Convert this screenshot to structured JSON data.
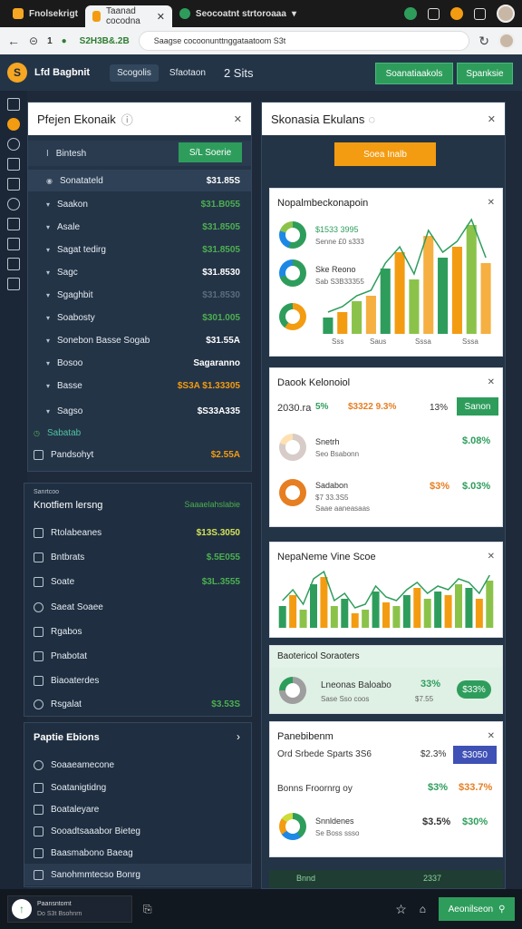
{
  "browser": {
    "tab1_title": "Fnolsekrigt",
    "tab2_title": "Taanad cocodna",
    "tab3_title": "Seocoatnt strtoroaaa",
    "url_number": "1",
    "url_host": "S2H3B&.2B",
    "url_path": "Saagse cocoonunttnggataatoom S3t",
    "tab2_close": "✕"
  },
  "app": {
    "name": "Lfd Bagbnit",
    "tabs": [
      "Scogolis",
      "Sfaotaon",
      "2 Sits"
    ],
    "btn_primary": "Soanatiaakols",
    "btn_secondary": "Spanksie"
  },
  "left_panel": {
    "title": "Pfejen Ekonaik",
    "header_row_label": "Bintesh",
    "header_btn": "S/L Soerie",
    "rows": [
      {
        "label": "Sonatateld",
        "value": "$31.85S"
      },
      {
        "label": "Saakon",
        "value": "$31.B055"
      },
      {
        "label": "Asale",
        "value": "$31.8505"
      },
      {
        "label": "Sagat tedirg",
        "value": "$31.8505"
      },
      {
        "label": "Sagc",
        "value": "$31.8530"
      },
      {
        "label": "Sgaghbit",
        "value": "$31.8530"
      },
      {
        "label": "Soabosty",
        "value": "$301.005"
      },
      {
        "label": "Sonebon Basse Sogab",
        "value": "$31.55A"
      },
      {
        "label": "Bosoo",
        "value": "Sagaranno"
      },
      {
        "label": "Basse",
        "value": "$S3A $1.33305"
      },
      {
        "label": "Sagso",
        "value": "$S33A335"
      },
      {
        "label": "Sabatab",
        "value": ""
      },
      {
        "label": "Pandsohyt",
        "value": "$2.55A"
      }
    ]
  },
  "left_panel2": {
    "header": "Sanrtcoo",
    "title": "Knotfiem lersng",
    "title_val": "Saaaelahslabie",
    "rows": [
      {
        "label": "Rtolabeanes",
        "value": "$13S.3050"
      },
      {
        "label": "Bntbrats",
        "value": "$.5E055"
      },
      {
        "label": "Soate",
        "value": "$3L.3555"
      },
      {
        "label": "Saeat Soaee",
        "value": ""
      },
      {
        "label": "Rgabos",
        "value": ""
      },
      {
        "label": "Pnabotat",
        "value": ""
      },
      {
        "label": "Biaoaterdes",
        "value": ""
      },
      {
        "label": "Rsgalat",
        "value": "$3.53S"
      }
    ]
  },
  "left_panel3": {
    "title": "Paptie Ebions",
    "rows": [
      {
        "label": "Soaaeamecone"
      },
      {
        "label": "Soatanigtidng"
      },
      {
        "label": "Boataleyare"
      },
      {
        "label": "Sooadtsaaabor Bieteg"
      },
      {
        "label": "Baasmabono Baeag"
      },
      {
        "label": "Sanohmmtecso Bonrg"
      }
    ]
  },
  "right": {
    "panel_title": "Skonasia Ekulans",
    "orange_btn": "Soea Inalb",
    "card1": {
      "title": "Nopalmbeckonapoin",
      "lines": [
        "$1533 3995",
        "Senne £0 s333",
        "Ske Reono",
        "Sab S3B33355"
      ],
      "bars": [
        3,
        4,
        6,
        7,
        12,
        15,
        10,
        18,
        14,
        16,
        20,
        13
      ],
      "xlabels": [
        "Sss",
        "Saus",
        "Sssa",
        "Sssa"
      ]
    },
    "card2": {
      "title": "Daook Kelonoiol",
      "top_left": "2030.ra",
      "top_left_val": "5%",
      "mid": "$3322 9.3%",
      "pct": "13%",
      "btn": "Sanon",
      "item1_label": "Snetrh",
      "item1_sub": "Seo Bsabonn",
      "item1_val": "$.08%",
      "item2_label": "Sadabon",
      "item2_sub": "$7 33.3S5",
      "item2_sub2": "Saae aaneasaas",
      "item2_pct": "$3%",
      "item2_val": "$.03%"
    },
    "card3": {
      "title": "NepaNeme Vine Scoe",
      "bars": [
        6,
        9,
        5,
        12,
        14,
        6,
        8,
        4,
        5,
        10,
        7,
        6,
        9,
        11,
        8,
        10,
        9,
        12,
        11,
        8,
        13
      ]
    },
    "card4": {
      "title": "Baotericol Soraoters",
      "label": "Lneonas Baloabo",
      "sub": "Sase Sso coos",
      "pct": "33%",
      "sub2": "$7.55",
      "btn": "$33%"
    },
    "card5": {
      "title": "Panebibenm",
      "row1_label": "Ord Srbede Sparts 3S6",
      "row1_val": "$2.3%",
      "row1_btn": "$3050",
      "row2_label": "Bonns Froornrg oy",
      "row2_val": "$3%",
      "row2_val2": "$33.7%",
      "row3_label": "Snnldenes",
      "row3_sub": "Se Boss ssso",
      "row3_val": "$3.5%",
      "row3_val2": "$30%"
    },
    "footer_left": "Bnnd",
    "footer_right": "2337"
  },
  "bottom": {
    "line1": "Paansntornt",
    "line2": "Do S3t Bsohnrn",
    "btn": "Aeonilseon"
  },
  "colors": {
    "green": "#2e9d5c",
    "orange": "#f39c12",
    "dark": "#243447"
  }
}
